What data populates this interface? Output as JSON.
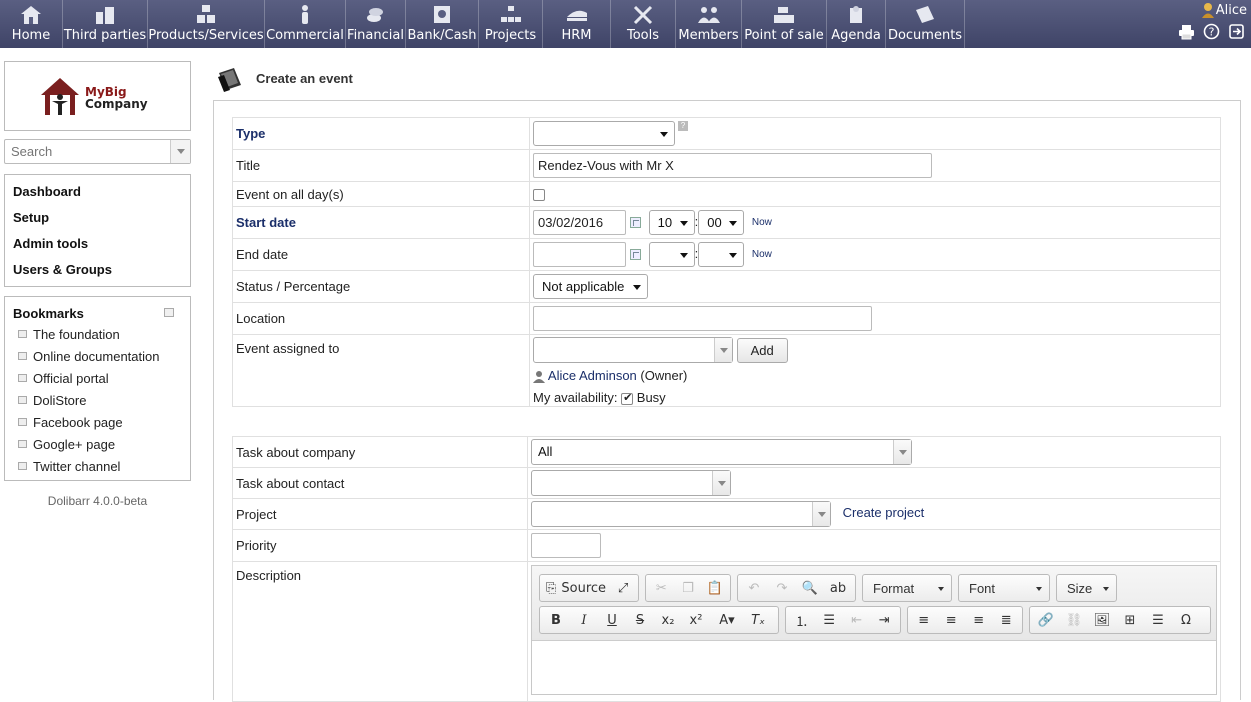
{
  "menu": [
    {
      "label": "Home",
      "icon": "home-icon",
      "width": 63
    },
    {
      "label": "Third parties",
      "icon": "buildings-icon",
      "width": 85
    },
    {
      "label": "Products/Services",
      "icon": "boxes-icon",
      "width": 117
    },
    {
      "label": "Commercial",
      "icon": "handshake-icon",
      "width": 81
    },
    {
      "label": "Financial",
      "icon": "coins-icon",
      "width": 60
    },
    {
      "label": "Bank/Cash",
      "icon": "safe-icon",
      "width": 73
    },
    {
      "label": "Projects",
      "icon": "hierarchy-icon",
      "width": 64
    },
    {
      "label": "HRM",
      "icon": "hrm-icon",
      "width": 68
    },
    {
      "label": "Tools",
      "icon": "tools-icon",
      "width": 65
    },
    {
      "label": "Members",
      "icon": "members-icon",
      "width": 66
    },
    {
      "label": "Point of sale",
      "icon": "cash-register-icon",
      "width": 85
    },
    {
      "label": "Agenda",
      "icon": "agenda-icon",
      "width": 59
    },
    {
      "label": "Documents",
      "icon": "documents-icon",
      "width": 79
    }
  ],
  "user": {
    "name": "Alice"
  },
  "logo": {
    "line1": "MyBig",
    "line2": "Company"
  },
  "search": {
    "placeholder": "Search"
  },
  "nav": [
    "Dashboard",
    "Setup",
    "Admin tools",
    "Users & Groups"
  ],
  "bookmarks": {
    "title": "Bookmarks",
    "items": [
      "The foundation",
      "Online documentation",
      "Official portal",
      "DoliStore",
      "Facebook page",
      "Google+ page",
      "Twitter channel"
    ]
  },
  "version": "Dolibarr 4.0.0-beta",
  "page_title": "Create an event",
  "form": {
    "type_label": "Type",
    "type_value": "",
    "title_label": "Title",
    "title_value": "Rendez-Vous with Mr X",
    "allday_label": "Event on all day(s)",
    "start_label": "Start date",
    "start_date": "03/02/2016",
    "start_hour": "10",
    "start_min": "00",
    "now": "Now",
    "end_label": "End date",
    "end_date": "",
    "status_label": "Status / Percentage",
    "status_value": "Not applicable",
    "location_label": "Location",
    "location_value": "",
    "assigned_label": "Event assigned to",
    "add_button": "Add",
    "assignee": "Alice Adminson",
    "owner_tag": "(Owner)",
    "availability_label": "My availability:",
    "busy_label": "Busy",
    "company_label": "Task about company",
    "company_value": "All",
    "contact_label": "Task about contact",
    "project_label": "Project",
    "create_project": "Create project",
    "priority_label": "Priority",
    "description_label": "Description"
  },
  "editor": {
    "source_label": "Source",
    "format_label": "Format",
    "font_label": "Font",
    "size_label": "Size"
  }
}
